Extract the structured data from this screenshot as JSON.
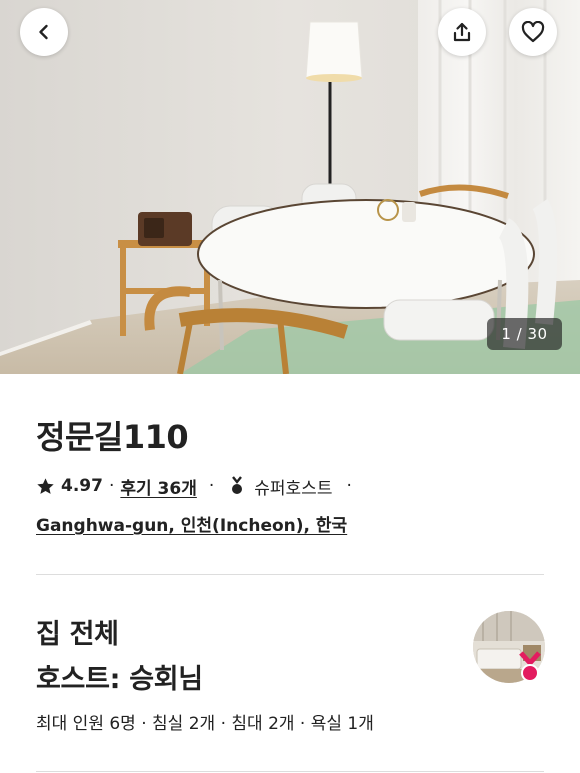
{
  "photo": {
    "counter": "1 / 30"
  },
  "header_buttons": {
    "back_icon": "chevron-left-icon",
    "share_icon": "share-icon",
    "like_icon": "heart-icon"
  },
  "listing": {
    "title": "정문길110",
    "rating": "4.97",
    "rating_separator": "·",
    "reviews": "후기 36개",
    "reviews_separator": "·",
    "superhost": "슈퍼호스트",
    "trailing_separator": "·",
    "location": "Ganghwa-gun, 인천(Incheon), 한국"
  },
  "host_section": {
    "listing_type": "집 전체",
    "host": "호스트: 승회님",
    "details": "최대 인원 6명 · 침실 2개 · 침대 2개 · 욕실 1개"
  },
  "colors": {
    "text": "#222222",
    "divider": "#dddddd",
    "superhost_badge": "#e31c5f"
  }
}
